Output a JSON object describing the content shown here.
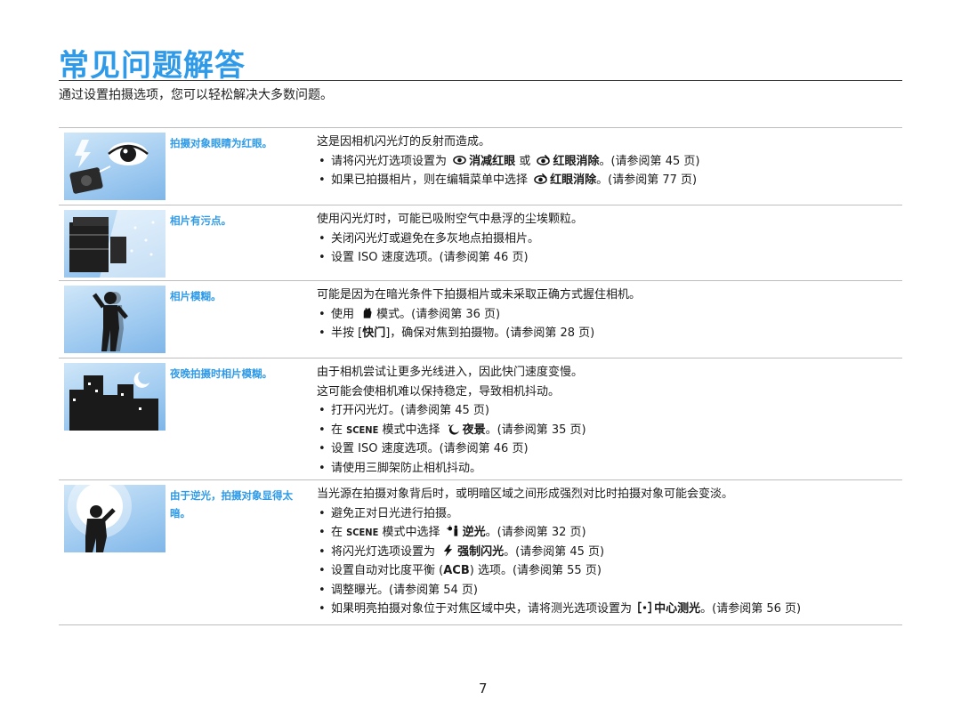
{
  "title": "常见问题解答",
  "intro": "通过设置拍摄选项，您可以轻松解决大多数问题。",
  "rows": [
    {
      "issue": "拍摄对象眼睛为红眼。",
      "desc": "这是因相机闪光灯的反射而造成。",
      "bullets": [
        {
          "pre": "请将闪光灯选项设置为",
          "icon1": "red-eye-icon",
          "opt1": "消减红眼",
          "mid": "或",
          "icon2": "red-eye-fix-icon",
          "opt2": "红眼消除",
          "post": "。(请参阅第 45 页)"
        },
        {
          "pre": "如果已拍摄相片，则在编辑菜单中选择",
          "icon1": "red-eye-fix-icon",
          "opt1": "红眼消除",
          "post": "。(请参阅第 77 页)"
        }
      ]
    },
    {
      "issue": "相片有污点。",
      "desc": "使用闪光灯时，可能已吸附空气中悬浮的尘埃颗粒。",
      "bullets": [
        {
          "text": "关闭闪光灯或避免在多灰地点拍摄相片。"
        },
        {
          "text": "设置 ISO 速度选项。(请参阅第 46 页)"
        }
      ]
    },
    {
      "issue": "相片模糊。",
      "desc": "可能是因为在暗光条件下拍摄相片或未采取正确方式握住相机。",
      "bullets": [
        {
          "pre": "使用",
          "icon1": "anti-shake-icon",
          "post": "模式。(请参阅第 36 页)"
        },
        {
          "pre": "半按 [",
          "opt1": "快门",
          "post": "]，确保对焦到拍摄物。(请参阅第 28 页)"
        }
      ]
    },
    {
      "issue": "夜晚拍摄时相片模糊。",
      "desc": "由于相机尝试让更多光线进入，因此快门速度变慢。",
      "desc2": "这可能会使相机难以保持稳定，导致相机抖动。",
      "bullets": [
        {
          "text": "打开闪光灯。(请参阅第 45 页)"
        },
        {
          "pre": "在",
          "scene": "SCENE",
          "mid": "模式中选择",
          "icon1": "night-scene-icon",
          "opt1": "夜景",
          "post": "。(请参阅第 35 页)"
        },
        {
          "text": "设置 ISO 速度选项。(请参阅第 46 页)"
        },
        {
          "text": "请使用三脚架防止相机抖动。"
        }
      ]
    },
    {
      "issue": "由于逆光，拍摄对象显得太暗。",
      "desc": "当光源在拍摄对象背后时，或明暗区域之间形成强烈对比时拍摄对象可能会变淡。",
      "bullets": [
        {
          "text": "避免正对日光进行拍摄。"
        },
        {
          "pre": "在",
          "scene": "SCENE",
          "mid": "模式中选择",
          "icon1": "backlight-icon",
          "opt1": "逆光",
          "post": "。(请参阅第 32 页)"
        },
        {
          "pre": "将闪光灯选项设置为",
          "icon1": "flash-on-icon",
          "opt1": "强制闪光",
          "post": "。(请参阅第 45 页)"
        },
        {
          "pre": "设置自动对比度平衡 (",
          "opt1": "ACB",
          "post": ") 选项。(请参阅第 55 页)"
        },
        {
          "text": "调整曝光。(请参阅第 54 页)"
        },
        {
          "pre": "如果明亮拍摄对象位于对焦区域中央，请将测光选项设置为",
          "icon1": "center-weighted-icon",
          "opt1": "中心测光",
          "post": "。(请参阅第 56 页)"
        }
      ]
    }
  ],
  "page_number": "7",
  "colors": {
    "accent": "#2f9be8",
    "thumb_bg": "#9fcaf0"
  }
}
